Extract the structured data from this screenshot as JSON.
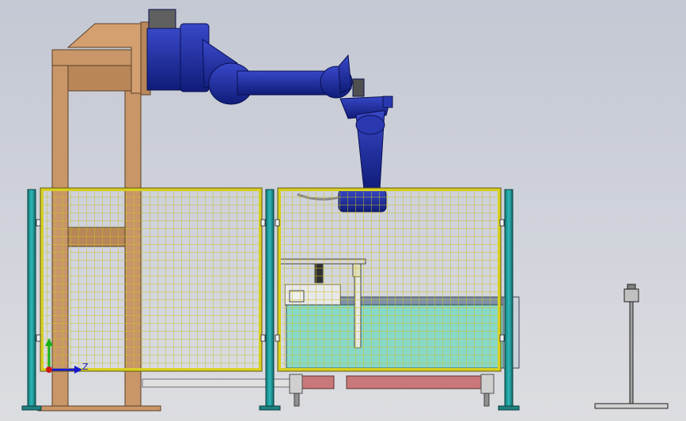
{
  "scene": {
    "type": "cad-drawing",
    "view": "side-elevation",
    "components": [
      "gantry-frame",
      "robot-arm",
      "safety-fence-left",
      "safety-fence-right",
      "tank",
      "conveyor",
      "tool-stand"
    ]
  },
  "axis": {
    "z_label": "Z",
    "x_color": "#d01818",
    "y_color": "#18b018",
    "z_color": "#1818d0"
  },
  "colors": {
    "background": "#cfd2da",
    "frame": "#c89668",
    "robot": "#1c2a9c",
    "fence": "#d8d020",
    "post": "#20a0a0",
    "tank": "#88d8c8",
    "conveyor": "#c87878"
  }
}
